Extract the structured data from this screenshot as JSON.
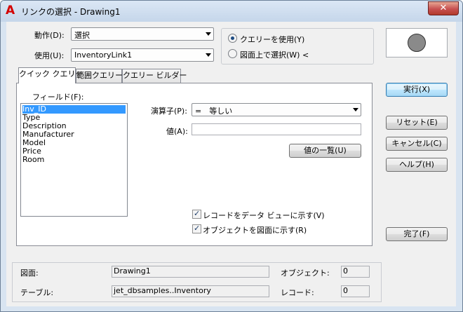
{
  "window": {
    "title": "リンクの選択 - Drawing1",
    "close_label": "✕",
    "app_logo": "A",
    "app_logo_color": "#d40000"
  },
  "action": {
    "label": "動作(D):",
    "value": "選択"
  },
  "use": {
    "label": "使用(U):",
    "value": "InventoryLink1"
  },
  "mode": {
    "use_query": "クエリーを使用(Y)",
    "select_in_drawing": "図面上で選択(W) <"
  },
  "tabs": [
    "クイック クエリー",
    "範囲クエリー",
    "クエリー ビルダー"
  ],
  "quick_query": {
    "field_label": "フィールド(F):",
    "fields": [
      "Inv_ID",
      "Type",
      "Description",
      "Manufacturer",
      "Model",
      "Price",
      "Room"
    ],
    "operator_label": "演算子(P):",
    "operator_value": "=　等しい",
    "value_label": "値(A):",
    "value_text": "",
    "value_list_button": "値の一覧(U)",
    "show_records": "レコードをデータ ビューに示す(V)",
    "show_objects": "オブジェクトを図面に示す(R)"
  },
  "buttons": {
    "execute": "実行(X)",
    "reset": "リセット(E)",
    "cancel": "キャンセル(C)",
    "help": "ヘルプ(H)",
    "done": "完了(F)"
  },
  "status": {
    "drawing_label": "図面:",
    "drawing_value": "Drawing1",
    "table_label": "テーブル:",
    "table_value": "jet_dbsamples..Inventory",
    "object_label": "オブジェクト:",
    "object_value": "0",
    "record_label": "レコード:",
    "record_value": "0"
  },
  "icons": {
    "preview": "circle-preview-icon"
  }
}
